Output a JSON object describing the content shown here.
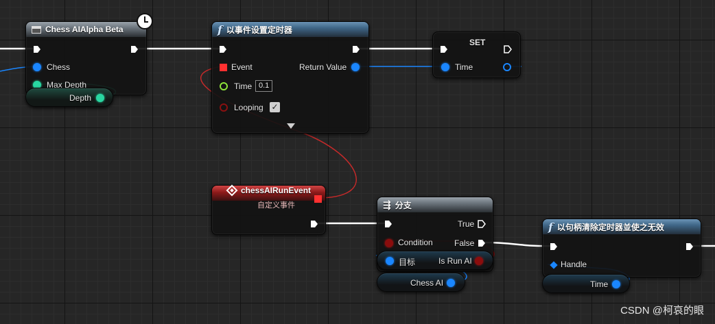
{
  "nodes": {
    "chess_ai_alpha_beta": {
      "title": "Chess AIAlpha Beta",
      "pins": {
        "chess": "Chess",
        "max_depth": "Max Depth",
        "depth": "Depth"
      }
    },
    "set_timer": {
      "title": "以事件设置定时器",
      "pins": {
        "event": "Event",
        "return_value": "Return Value",
        "time": "Time",
        "time_value": "0.1",
        "looping": "Looping"
      }
    },
    "set_node": {
      "title": "SET",
      "pins": {
        "time": "Time"
      }
    },
    "custom_event": {
      "title": "chessAIRunEvent",
      "subtitle": "自定义事件"
    },
    "branch": {
      "title": "分支",
      "pins": {
        "true": "True",
        "false": "False",
        "condition": "Condition",
        "target": "目标",
        "is_run_ai": "Is Run AI",
        "chess_ai": "Chess AI"
      }
    },
    "clear_timer": {
      "title": "以句柄清除定时器並使之无效",
      "pins": {
        "handle": "Handle",
        "time": "Time"
      }
    }
  },
  "colors": {
    "exec_wire": "#ffffff",
    "object_wire": "#1a86ff",
    "struct_wire": "#29d6a1",
    "delegate_wire": "#d12b2b",
    "bool_wire": "#8a0d0d",
    "background": "#262626"
  },
  "icons": {
    "function": "function-f-icon",
    "struct": "struct-icon",
    "branch": "branch-icon",
    "event": "event-diamond-icon",
    "latent": "clock-icon"
  },
  "watermark": "CSDN @柯哀的眼"
}
